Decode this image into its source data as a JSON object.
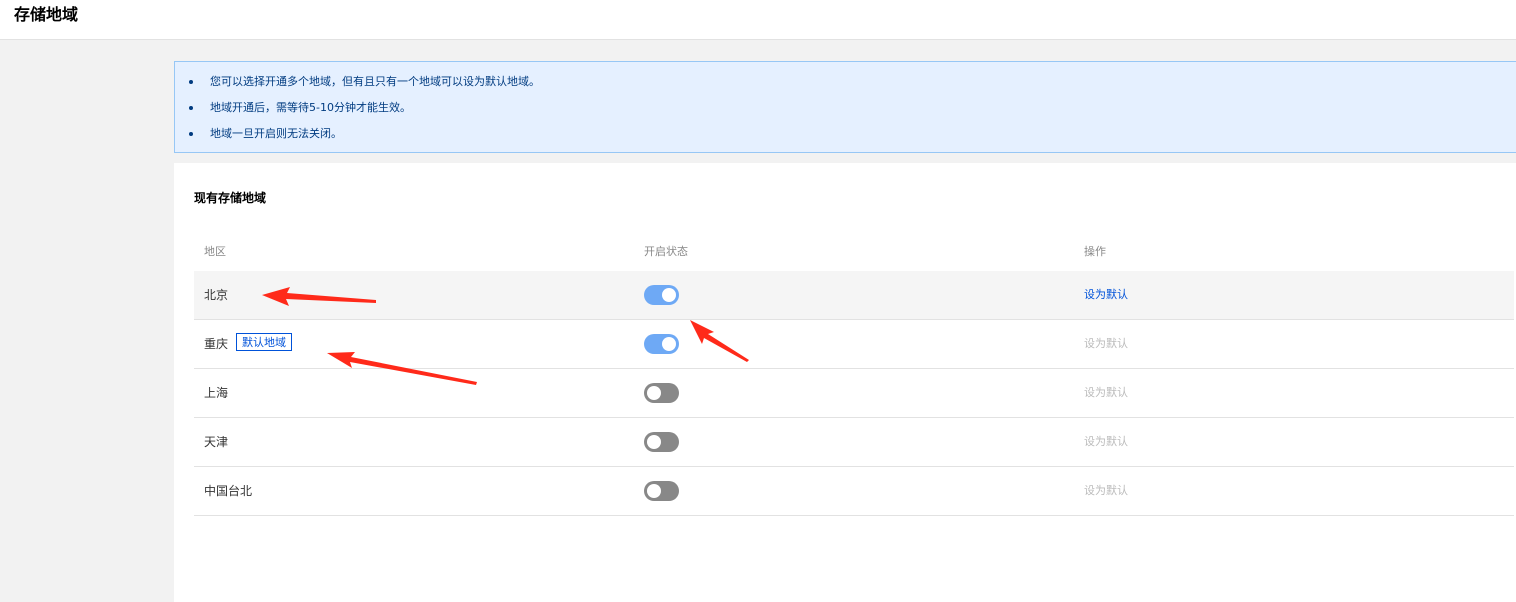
{
  "header": {
    "title": "存储地域"
  },
  "notice": {
    "items": [
      "您可以选择开通多个地域，但有且只有一个地域可以设为默认地域。",
      "地域开通后，需等待5-10分钟才能生效。",
      "地域一旦开启则无法关闭。"
    ]
  },
  "section": {
    "title": "现有存储地域"
  },
  "table": {
    "columns": [
      "地区",
      "开启状态",
      "操作"
    ],
    "rows": [
      {
        "region": "北京",
        "badge": "",
        "enabled": true,
        "action": "设为默认",
        "action_enabled": true
      },
      {
        "region": "重庆",
        "badge": "默认地域",
        "enabled": true,
        "action": "设为默认",
        "action_enabled": false
      },
      {
        "region": "上海",
        "badge": "",
        "enabled": false,
        "action": "设为默认",
        "action_enabled": false
      },
      {
        "region": "天津",
        "badge": "",
        "enabled": false,
        "action": "设为默认",
        "action_enabled": false
      },
      {
        "region": "中国台北",
        "badge": "",
        "enabled": false,
        "action": "设为默认",
        "action_enabled": false
      }
    ]
  },
  "colors": {
    "accent": "#0052d9",
    "switch_on": "#6ea9f5",
    "switch_off": "#888888",
    "notice_bg": "#e5f0ff",
    "annotation_arrow": "#ff2a1a"
  }
}
